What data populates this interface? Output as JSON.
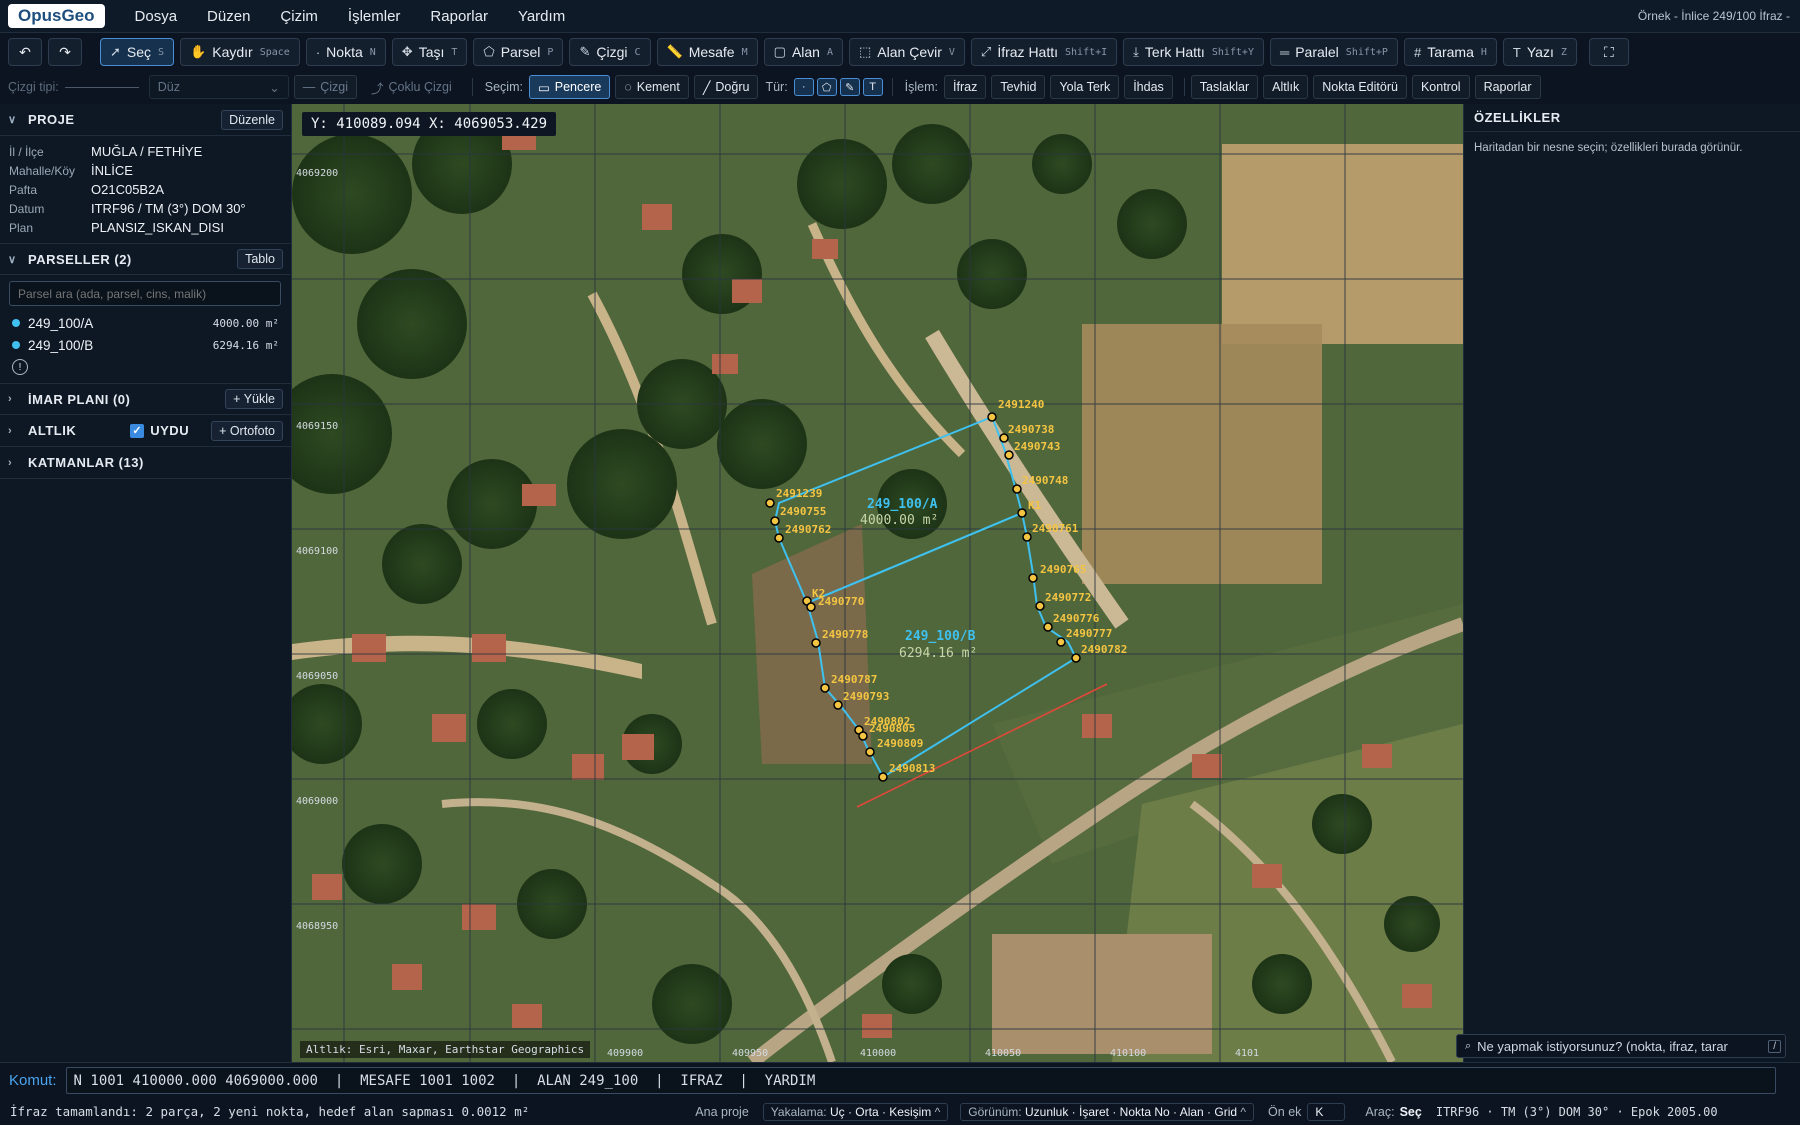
{
  "app": {
    "logo": "OpusGeo",
    "title": "Örnek - İnlice 249/100 İfraz -"
  },
  "menu": [
    "Dosya",
    "Düzen",
    "Çizim",
    "İşlemler",
    "Raporlar",
    "Yardım"
  ],
  "toolbar": [
    {
      "label": "Seç",
      "key": "S",
      "icon": "cursor-icon",
      "active": true
    },
    {
      "label": "Kaydır",
      "key": "Space",
      "icon": "hand-icon"
    },
    {
      "label": "Nokta",
      "key": "N",
      "icon": "point-icon"
    },
    {
      "label": "Taşı",
      "key": "T",
      "icon": "move-icon"
    },
    {
      "label": "Parsel",
      "key": "P",
      "icon": "pentagon-icon"
    },
    {
      "label": "Çizgi",
      "key": "C",
      "icon": "pen-icon"
    },
    {
      "label": "Mesafe",
      "key": "M",
      "icon": "ruler-icon"
    },
    {
      "label": "Alan",
      "key": "A",
      "icon": "square-icon"
    },
    {
      "label": "Alan Çevir",
      "key": "V",
      "icon": "dashed-square-icon"
    },
    {
      "label": "İfraz Hattı",
      "key": "Shift+I",
      "icon": "split-icon"
    },
    {
      "label": "Terk Hattı",
      "key": "Shift+Y",
      "icon": "download-icon"
    },
    {
      "label": "Paralel",
      "key": "Shift+P",
      "icon": "parallel-icon"
    },
    {
      "label": "Tarama",
      "key": "H",
      "icon": "hash-icon"
    },
    {
      "label": "Yazı",
      "key": "Z",
      "icon": "text-icon"
    }
  ],
  "options": {
    "line_type_label": "Çizgi tipi:",
    "line_style": "Düz",
    "line_btn": "Çizgi",
    "polyline_btn": "Çoklu Çizgi",
    "selection_label": "Seçim:",
    "window": "Pencere",
    "lasso": "Kement",
    "line_sel": "Doğru",
    "type_label": "Tür:",
    "ops_label": "İşlem:",
    "ops": [
      "İfraz",
      "Tevhid",
      "Yola Terk",
      "İhdas"
    ],
    "extra": [
      "Taslaklar",
      "Altlık",
      "Nokta Editörü",
      "Kontrol",
      "Raporlar"
    ]
  },
  "project": {
    "title": "PROJE",
    "edit": "Düzenle",
    "fields": [
      {
        "k": "İl / İlçe",
        "v": "MUĞLA / FETHİYE"
      },
      {
        "k": "Mahalle/Köy",
        "v": "İNLİCE"
      },
      {
        "k": "Pafta",
        "v": "O21C05B2A"
      },
      {
        "k": "Datum",
        "v": "ITRF96 / TM (3°) DOM 30°"
      },
      {
        "k": "Plan",
        "v": "PLANSIZ_ISKAN_DISI"
      }
    ]
  },
  "parcels": {
    "title": "PARSELLER (2)",
    "table": "Tablo",
    "search_placeholder": "Parsel ara (ada, parsel, cins, malik)",
    "items": [
      {
        "name": "249_100/A",
        "area": "4000.00 m²"
      },
      {
        "name": "249_100/B",
        "area": "6294.16 m²"
      }
    ]
  },
  "sections": {
    "imar": {
      "title": "İMAR PLANI (0)",
      "btn": "+ Yükle"
    },
    "altlik": {
      "title": "ALTLIK",
      "check": "UYDU",
      "btn": "+ Ortofoto"
    },
    "layers": {
      "title": "KATMANLAR (13)"
    }
  },
  "map": {
    "cursor": "Y: 410089.094  X: 4069053.429",
    "attribution": "Altlık: Esri, Maxar, Earthstar Geographics",
    "grid_left": [
      "4069200",
      "4069150",
      "4069100",
      "4069050",
      "4069000",
      "4068950"
    ],
    "grid_bottom": [
      "409900",
      "409950",
      "410000",
      "410050",
      "410100",
      "4101"
    ],
    "parcel_a": {
      "name": "249_100/A",
      "area": "4000.00 m²"
    },
    "parcel_b": {
      "name": "249_100/B",
      "area": "6294.16 m²"
    },
    "points": [
      "2491240",
      "2490738",
      "2490743",
      "2490748",
      "K1",
      "2490761",
      "2490765",
      "2490772",
      "2490776",
      "2490777",
      "2490782",
      "2491239",
      "2490755",
      "2490762",
      "K2",
      "2490770",
      "2490778",
      "2490787",
      "2490793",
      "2490802",
      "2490805",
      "2490809",
      "2490813"
    ],
    "colors": {
      "parcel_line": "#3fc1f0",
      "label": "#f4c542",
      "road": "#e0483a"
    }
  },
  "properties": {
    "title": "ÖZELLİKLER",
    "hint": "Haritadan bir nesne seçin; özellikleri burada görünür."
  },
  "ask": {
    "text": "Ne yapmak istiyorsunuz? (nokta, ifraz, tarar",
    "key": "/"
  },
  "command": {
    "label": "Komut:",
    "value": "N 1001 410000.000 4069000.000  |  MESAFE 1001 1002  |  ALAN 249_100  |  IFRAZ  |  YARDIM"
  },
  "status": {
    "message": "İfraz tamamlandı: 2 parça, 2 yeni nokta, hedef alan sapması 0.0012 m²",
    "project": "Ana proje",
    "snap_label": "Yakalama:",
    "snap": "Uç · Orta · Kesişim",
    "view_label": "Görünüm:",
    "view": "Uzunluk · İşaret · Nokta No · Alan · Grid",
    "prefix_label": "Ön ek",
    "prefix": "K",
    "tool_label": "Araç:",
    "tool": "Seç",
    "crs": "ITRF96 · TM (3°) DOM 30° · Epok 2005.00"
  }
}
